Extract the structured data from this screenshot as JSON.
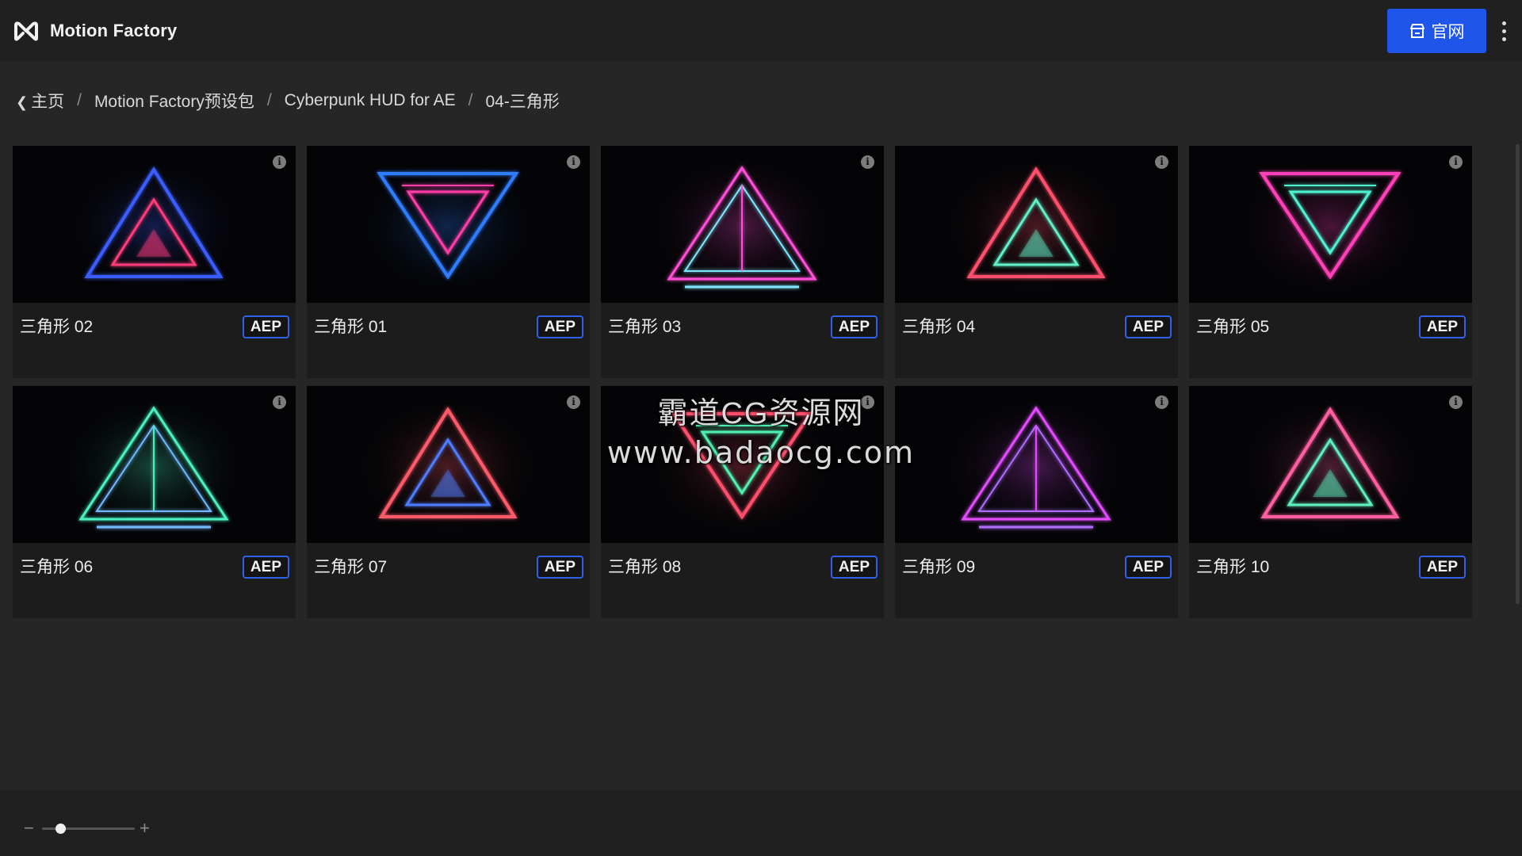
{
  "app": {
    "name": "Motion Factory",
    "logo_icon": "motion-factory-logo-icon"
  },
  "header": {
    "site_button_label": "官网",
    "site_button_icon": "store-icon",
    "menu_icon": "more-vertical-icon"
  },
  "breadcrumb": [
    "主页",
    "Motion Factory预设包",
    "Cyberpunk HUD for AE",
    "04-三角形"
  ],
  "cards": [
    {
      "title": "三角形 02",
      "badge": "AEP",
      "colors": [
        "#3a5cff",
        "#ff3a7a"
      ]
    },
    {
      "title": "三角形 01",
      "badge": "AEP",
      "colors": [
        "#2f7bff",
        "#ff3da8"
      ]
    },
    {
      "title": "三角形 03",
      "badge": "AEP",
      "colors": [
        "#ff4fd8",
        "#7fe8ff"
      ]
    },
    {
      "title": "三角形 04",
      "badge": "AEP",
      "colors": [
        "#ff4f6d",
        "#5ff0c8"
      ]
    },
    {
      "title": "三角形 05",
      "badge": "AEP",
      "colors": [
        "#ff3fb8",
        "#4ff2d0"
      ]
    },
    {
      "title": "三角形 06",
      "badge": "AEP",
      "colors": [
        "#48f0c0",
        "#6fb8ff"
      ]
    },
    {
      "title": "三角形 07",
      "badge": "AEP",
      "colors": [
        "#ff5a6a",
        "#4f7dff"
      ]
    },
    {
      "title": "三角形 08",
      "badge": "AEP",
      "colors": [
        "#ff4f6d",
        "#4ff0b0"
      ]
    },
    {
      "title": "三角形 09",
      "badge": "AEP",
      "colors": [
        "#e34cff",
        "#b06cff"
      ]
    },
    {
      "title": "三角形 10",
      "badge": "AEP",
      "colors": [
        "#ff5fa0",
        "#5ff0c0"
      ]
    }
  ],
  "watermark": {
    "line1": "霸道CG资源网",
    "line2": "www.badaocg.com"
  },
  "zoom": {
    "minus_label": "−",
    "plus_label": "+",
    "level": 0.2
  },
  "colors": {
    "accent": "#1f55e8",
    "badge_border": "#2f62e8"
  }
}
